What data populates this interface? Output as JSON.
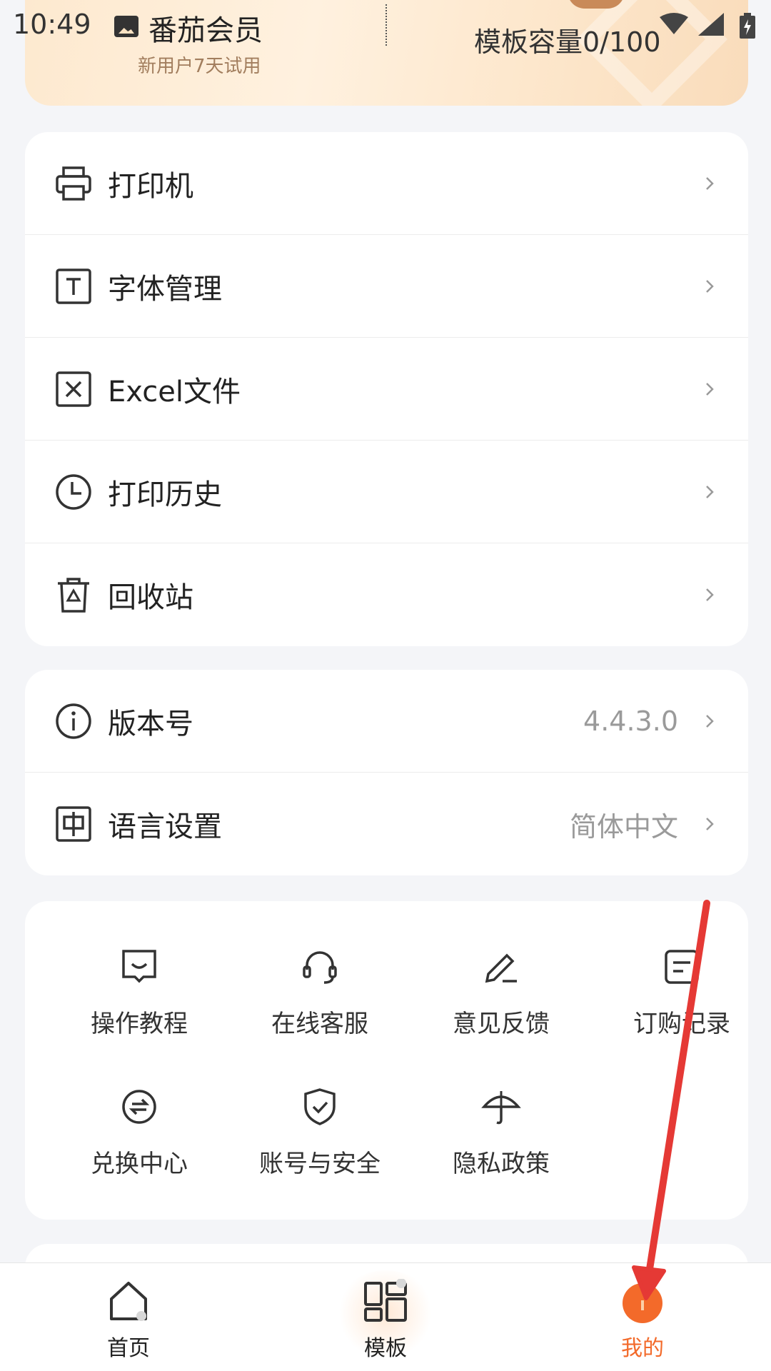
{
  "status_bar": {
    "time": "10:49"
  },
  "member_card": {
    "title": "番茄会员",
    "subtitle": "新用户7天试用",
    "capacity": "模板容量0/100"
  },
  "menu_main": [
    {
      "label": "打印机",
      "icon": "printer-icon"
    },
    {
      "label": "字体管理",
      "icon": "font-icon"
    },
    {
      "label": "Excel文件",
      "icon": "excel-icon"
    },
    {
      "label": "打印历史",
      "icon": "clock-icon"
    },
    {
      "label": "回收站",
      "icon": "recycle-bin-icon"
    }
  ],
  "menu_settings": [
    {
      "label": "版本号",
      "value": "4.4.3.0",
      "icon": "info-icon"
    },
    {
      "label": "语言设置",
      "value": "简体中文",
      "icon": "language-icon"
    }
  ],
  "grid": [
    {
      "label": "操作教程",
      "icon": "tutorial-icon"
    },
    {
      "label": "在线客服",
      "icon": "headset-icon"
    },
    {
      "label": "意见反馈",
      "icon": "pen-icon"
    },
    {
      "label": "订购记录",
      "icon": "orders-icon"
    },
    {
      "label": "兑换中心",
      "icon": "exchange-icon"
    },
    {
      "label": "账号与安全",
      "icon": "shield-icon"
    },
    {
      "label": "隐私政策",
      "icon": "umbrella-icon"
    }
  ],
  "bottom_nav": [
    {
      "label": "首页",
      "icon": "home-icon"
    },
    {
      "label": "模板",
      "icon": "template-icon"
    },
    {
      "label": "我的",
      "icon": "profile-icon",
      "active": true
    }
  ],
  "colors": {
    "accent": "#f36a2a",
    "annotation_arrow": "#e53935",
    "background": "#f4f5f8"
  }
}
